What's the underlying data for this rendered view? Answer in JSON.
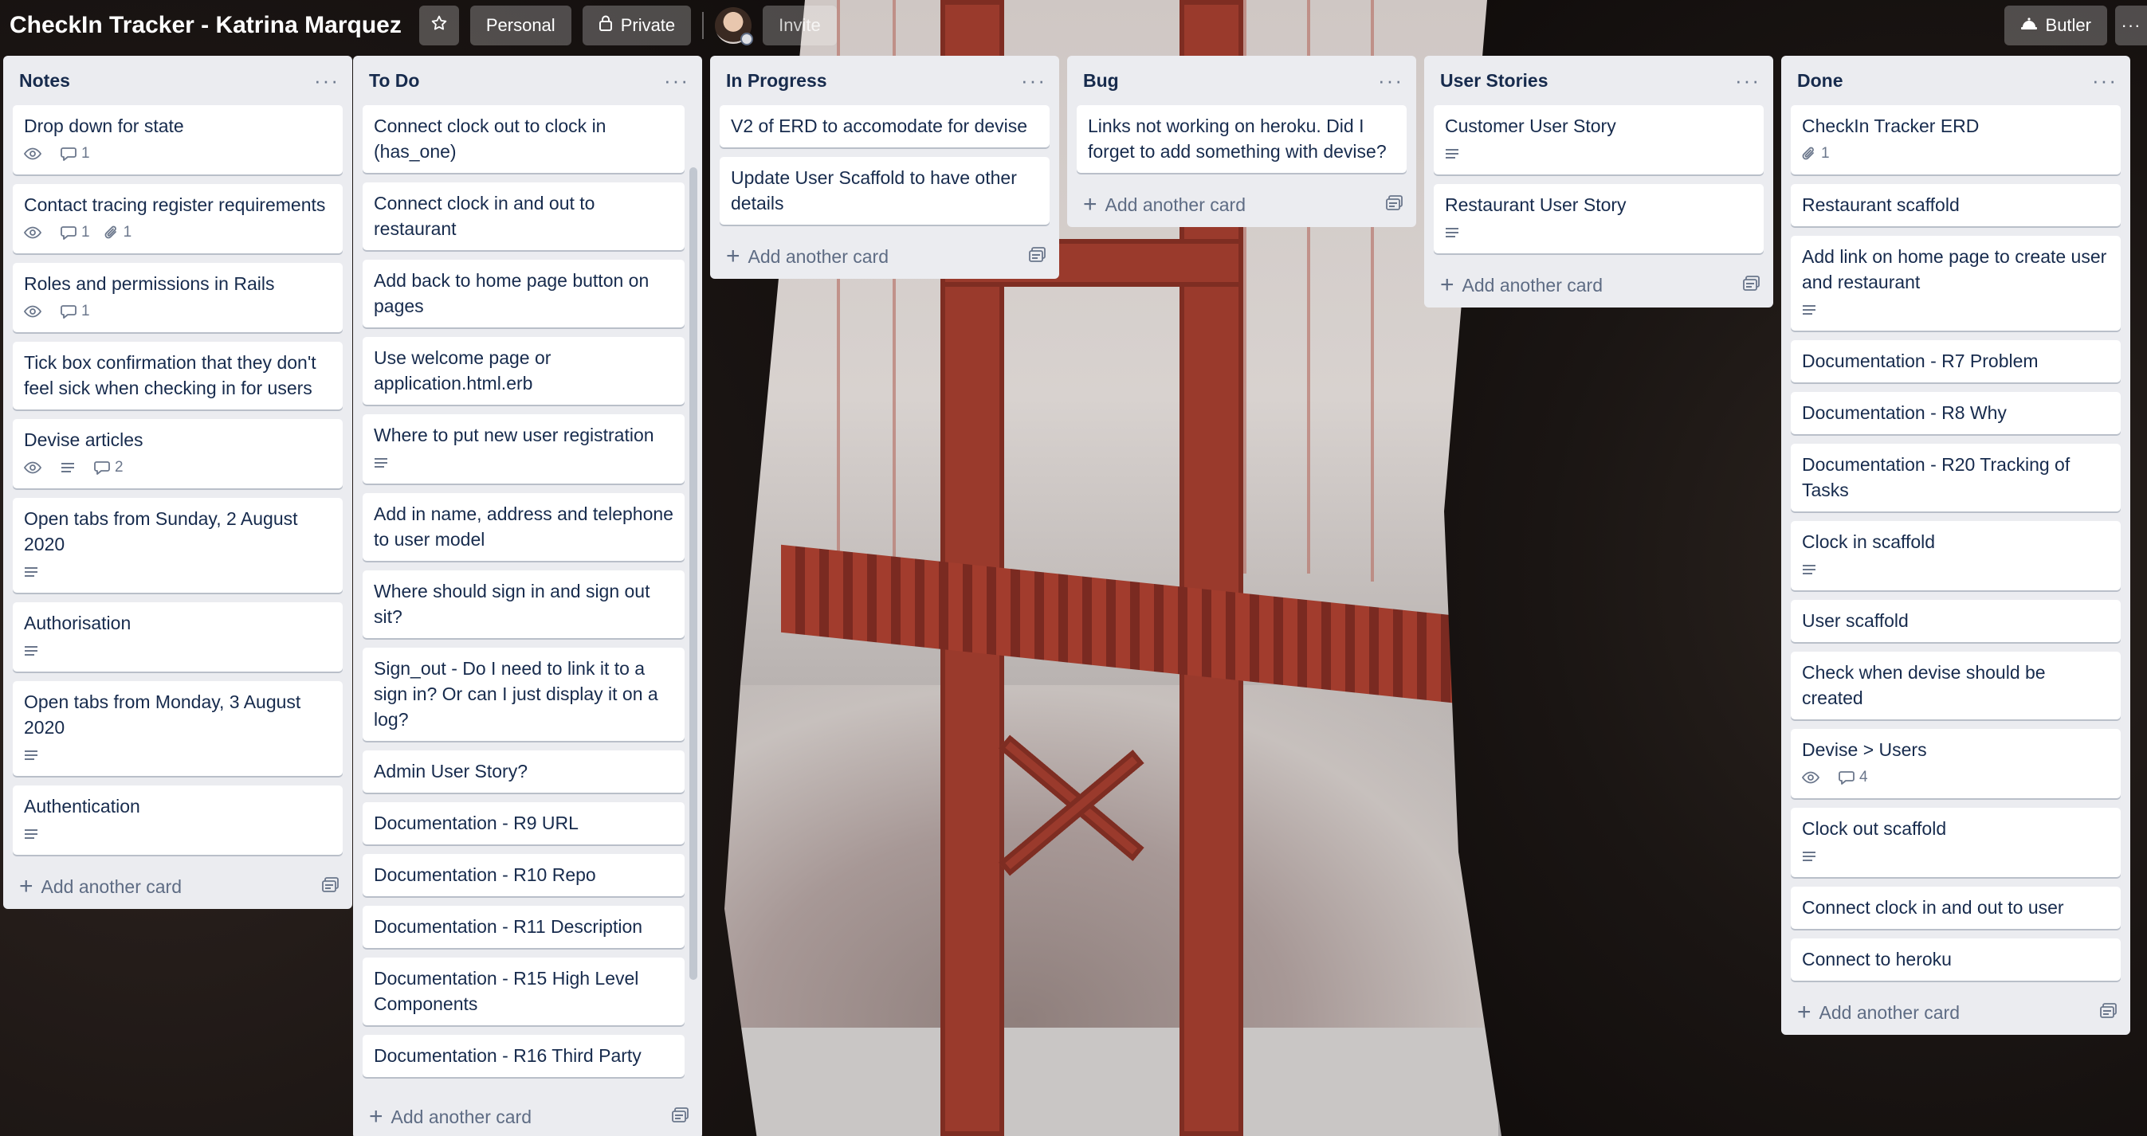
{
  "header": {
    "title": "CheckIn Tracker - Katrina Marquez",
    "workspace_label": "Personal",
    "visibility_label": "Private",
    "invite_label": "Invite",
    "butler_label": "Butler"
  },
  "lists": [
    {
      "title": "Notes",
      "add_label": "Add another card",
      "cards": [
        {
          "title": "Drop down for state",
          "watch": true,
          "description": false,
          "comments": "1",
          "attachments": null
        },
        {
          "title": "Contact tracing register requirements",
          "watch": true,
          "description": false,
          "comments": "1",
          "attachments": "1"
        },
        {
          "title": "Roles and permissions in Rails",
          "watch": true,
          "description": false,
          "comments": "1",
          "attachments": null
        },
        {
          "title": "Tick box confirmation that they don't feel sick when checking in for users",
          "watch": false,
          "description": false,
          "comments": null,
          "attachments": null
        },
        {
          "title": "Devise articles",
          "watch": true,
          "description": true,
          "comments": "2",
          "attachments": null
        },
        {
          "title": "Open tabs from Sunday, 2 August 2020",
          "watch": false,
          "description": true,
          "comments": null,
          "attachments": null
        },
        {
          "title": "Authorisation",
          "watch": false,
          "description": true,
          "comments": null,
          "attachments": null
        },
        {
          "title": "Open tabs from Monday, 3 August 2020",
          "watch": false,
          "description": true,
          "comments": null,
          "attachments": null
        },
        {
          "title": "Authentication",
          "watch": false,
          "description": true,
          "comments": null,
          "attachments": null
        }
      ]
    },
    {
      "title": "To Do",
      "add_label": "Add another card",
      "cards": [
        {
          "title": "Connect clock out to clock in (has_one)"
        },
        {
          "title": "Connect clock in and out to restaurant"
        },
        {
          "title": "Add back to home page button on pages"
        },
        {
          "title": "Use welcome page or application.html.erb"
        },
        {
          "title": "Where to put new user registration",
          "description": true
        },
        {
          "title": "Add in name, address and telephone to user model"
        },
        {
          "title": "Where should sign in and sign out sit?"
        },
        {
          "title": "Sign_out - Do I need to link it to a sign in? Or can I just display it on a log?"
        },
        {
          "title": "Admin User Story?"
        },
        {
          "title": "Documentation - R9 URL"
        },
        {
          "title": "Documentation - R10 Repo"
        },
        {
          "title": "Documentation - R11 Description"
        },
        {
          "title": "Documentation - R15 High Level Components"
        },
        {
          "title": "Documentation - R16 Third Party"
        }
      ]
    },
    {
      "title": "In Progress",
      "add_label": "Add another card",
      "cards": [
        {
          "title": "V2 of ERD to accomodate for devise"
        },
        {
          "title": "Update User Scaffold to have other details"
        }
      ]
    },
    {
      "title": "Bug",
      "add_label": "Add another card",
      "cards": [
        {
          "title": "Links not working on heroku. Did I forget to add something with devise?"
        }
      ]
    },
    {
      "title": "User Stories",
      "add_label": "Add another card",
      "cards": [
        {
          "title": "Customer User Story",
          "description": true
        },
        {
          "title": "Restaurant User Story",
          "description": true
        }
      ]
    },
    {
      "title": "Done",
      "add_label": "Add another card",
      "cards": [
        {
          "title": "CheckIn Tracker ERD",
          "attachments": "1"
        },
        {
          "title": "Restaurant scaffold"
        },
        {
          "title": "Add link on home page to create user and restaurant",
          "description": true
        },
        {
          "title": "Documentation - R7 Problem"
        },
        {
          "title": "Documentation - R8 Why"
        },
        {
          "title": "Documentation - R20 Tracking of Tasks"
        },
        {
          "title": "Clock in scaffold",
          "description": true
        },
        {
          "title": "User scaffold"
        },
        {
          "title": "Check when devise should be created"
        },
        {
          "title": "Devise > Users",
          "watch": true,
          "comments": "4"
        },
        {
          "title": "Clock out scaffold",
          "description": true
        },
        {
          "title": "Connect clock in and out to user"
        },
        {
          "title": "Connect to heroku"
        }
      ]
    }
  ]
}
